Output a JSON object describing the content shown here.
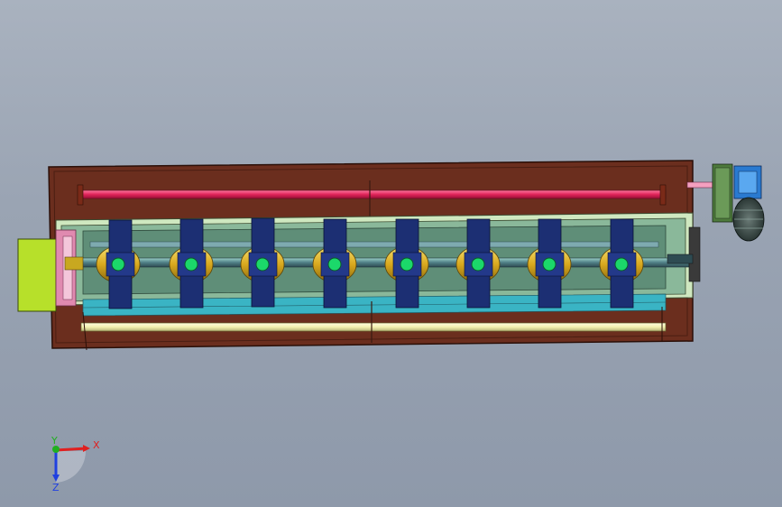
{
  "viewport": {
    "background_top": "#a9b2bf",
    "background_bottom": "#8e99aa"
  },
  "colors": {
    "frame": "#6b2e1e",
    "frame_dark": "#4a1e12",
    "rod_red": "#e0245a",
    "rod_yellow": "#f4f2b0",
    "trough": "#8ab89a",
    "inner_bed": "#5f8e78",
    "clamp_blue": "#1c2f73",
    "roller_yellow": "#e6c02a",
    "roller_green": "#1bd86a",
    "end_block": "#b7e02a",
    "end_plate_pink": "#e08ab0",
    "motor_blue": "#2a7ad0",
    "gearbox_green": "#4d7a3c",
    "axis_x": "#e02020",
    "axis_y": "#20b020",
    "axis_z": "#2040e0"
  },
  "clamps": [
    {
      "id": 1
    },
    {
      "id": 2
    },
    {
      "id": 3
    },
    {
      "id": 4
    },
    {
      "id": 5
    },
    {
      "id": 6
    },
    {
      "id": 7
    },
    {
      "id": 8
    }
  ],
  "triad": {
    "x_label": "X",
    "y_label": "Y",
    "z_label": "Z"
  }
}
